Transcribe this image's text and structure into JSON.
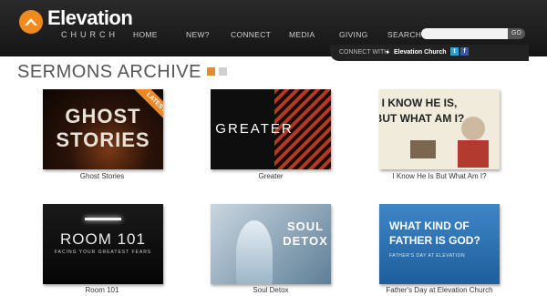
{
  "brand": {
    "name": "Elevation",
    "sub": "CHURCH"
  },
  "nav": {
    "items": [
      "HOME",
      "NEW?",
      "CONNECT",
      "MEDIA",
      "GIVING",
      "SEARCH"
    ],
    "search_placeholder": "",
    "go_label": "GO"
  },
  "connect": {
    "label": "CONNECT WITH",
    "arrow": "▸",
    "name": "Elevation Church",
    "twitter": "t",
    "facebook": "f"
  },
  "page": {
    "title": "SERMONS ARCHIVE"
  },
  "sermons": [
    {
      "title": "Ghost Stories",
      "art_lines": [
        "GHOST",
        "STORIES"
      ],
      "badge": "LATEST"
    },
    {
      "title": "Greater",
      "art_lines": [
        "GREATER"
      ]
    },
    {
      "title": "I Know He Is But What Am I?",
      "art_lines": [
        "I KNOW HE IS,",
        "BUT WHAT AM I?"
      ]
    },
    {
      "title": "Room 101",
      "art_lines": [
        "ROOM 101",
        "FACING YOUR GREATEST FEARS"
      ]
    },
    {
      "title": "Soul Detox",
      "art_lines": [
        "SOUL",
        "DETOX"
      ]
    },
    {
      "title": "Father's Day at Elevation Church",
      "art_lines": [
        "WHAT KIND OF",
        "FATHER IS GOD?",
        "FATHER'S DAY AT ELEVATION"
      ]
    }
  ],
  "colors": {
    "accent": "#e8892b",
    "header": "#1c1c1c"
  }
}
